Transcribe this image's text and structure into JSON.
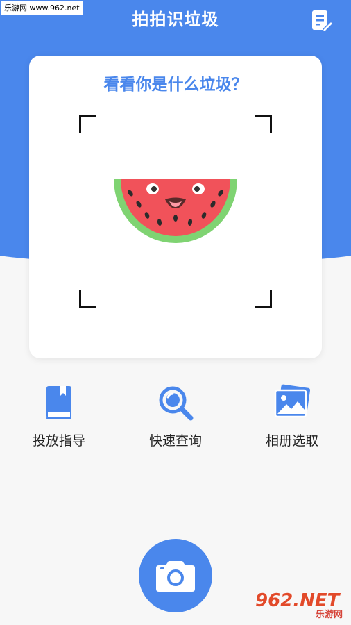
{
  "watermark_top": "乐游网 www.962.net",
  "header": {
    "title": "拍拍识垃圾",
    "notes_icon": "edit-notes-icon"
  },
  "scan_card": {
    "title": "看看你是什么垃圾？",
    "image": "watermelon-illustration"
  },
  "actions": [
    {
      "label": "投放指导",
      "icon": "book-icon"
    },
    {
      "label": "快速查询",
      "icon": "search-icon"
    },
    {
      "label": "相册选取",
      "icon": "gallery-icon"
    }
  ],
  "camera": {
    "icon": "camera-icon"
  },
  "watermark_bottom": {
    "text": "962.NET",
    "sub": "乐游网"
  },
  "colors": {
    "primary": "#4a87ec",
    "background": "#f7f7f7",
    "card": "#ffffff"
  }
}
